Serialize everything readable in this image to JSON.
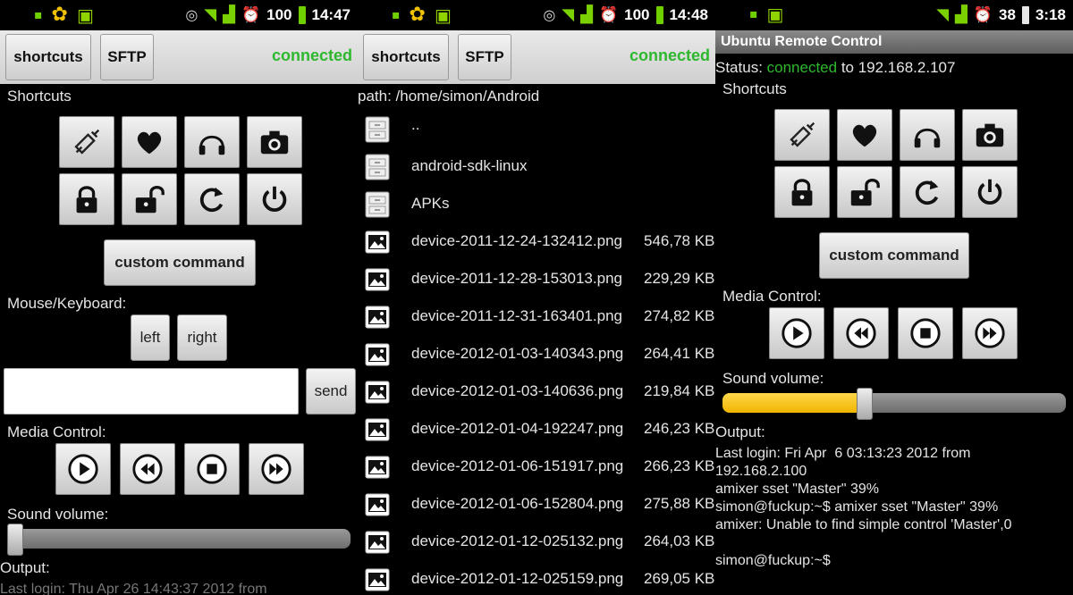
{
  "panel1": {
    "status_time": "14:47",
    "battery": "100",
    "toolbar": {
      "shortcuts_label": "shortcuts",
      "sftp_label": "SFTP",
      "connection": "connected"
    },
    "shortcuts_label": "Shortcuts",
    "shortcut_icons": [
      "syringe-icon",
      "heart-icon",
      "headphones-icon",
      "camera-icon",
      "lock-icon",
      "unlock-icon",
      "refresh-icon",
      "power-icon"
    ],
    "custom_command_label": "custom command",
    "mouse_keyboard_label": "Mouse/Keyboard:",
    "left_label": "left",
    "right_label": "right",
    "input_value": "",
    "send_label": "send",
    "media_control_label": "Media Control:",
    "media_icons": [
      "play-icon",
      "rewind-icon",
      "stop-icon",
      "fast-forward-icon"
    ],
    "sound_volume_label": "Sound volume:",
    "volume_fraction": 0.0,
    "output_label": "Output:",
    "output_text": "Last login: Thu Apr 26 14:43:37 2012 from"
  },
  "panel2": {
    "status_time": "14:48",
    "battery": "100",
    "toolbar": {
      "shortcuts_label": "shortcuts",
      "sftp_label": "SFTP",
      "connection": "connected"
    },
    "path": "path: /home/simon/Android",
    "files": [
      {
        "type": "folder",
        "name": "..",
        "size": ""
      },
      {
        "type": "folder",
        "name": "android-sdk-linux",
        "size": ""
      },
      {
        "type": "folder",
        "name": "APKs",
        "size": ""
      },
      {
        "type": "image",
        "name": "device-2011-12-24-132412.png",
        "size": "546,78 KB"
      },
      {
        "type": "image",
        "name": "device-2011-12-28-153013.png",
        "size": "229,29 KB"
      },
      {
        "type": "image",
        "name": "device-2011-12-31-163401.png",
        "size": "274,82 KB"
      },
      {
        "type": "image",
        "name": "device-2012-01-03-140343.png",
        "size": "264,41 KB"
      },
      {
        "type": "image",
        "name": "device-2012-01-03-140636.png",
        "size": "219,84 KB"
      },
      {
        "type": "image",
        "name": "device-2012-01-04-192247.png",
        "size": "246,23 KB"
      },
      {
        "type": "image",
        "name": "device-2012-01-06-151917.png",
        "size": "266,23 KB"
      },
      {
        "type": "image",
        "name": "device-2012-01-06-152804.png",
        "size": "275,88 KB"
      },
      {
        "type": "image",
        "name": "device-2012-01-12-025132.png",
        "size": "264,03 KB"
      },
      {
        "type": "image",
        "name": "device-2012-01-12-025159.png",
        "size": "269,05 KB"
      }
    ]
  },
  "panel3": {
    "status_time": "3:18",
    "battery": "38",
    "title": "Ubuntu Remote Control",
    "status_prefix": "Status: ",
    "status_connected": "connected",
    "status_suffix": " to 192.168.2.107",
    "shortcuts_label": "Shortcuts",
    "custom_command_label": "custom command",
    "media_control_label": "Media Control:",
    "sound_volume_label": "Sound volume:",
    "volume_fraction": 0.39,
    "output_label": "Output:",
    "output_lines": [
      "Last login: Fri Apr  6 03:13:23 2012 from",
      "192.168.2.100",
      "amixer sset \"Master\" 39%",
      "simon@fuckup:~$ amixer sset \"Master\" 39%",
      "amixer: Unable to find simple control 'Master',0",
      "",
      "simon@fuckup:~$"
    ]
  }
}
